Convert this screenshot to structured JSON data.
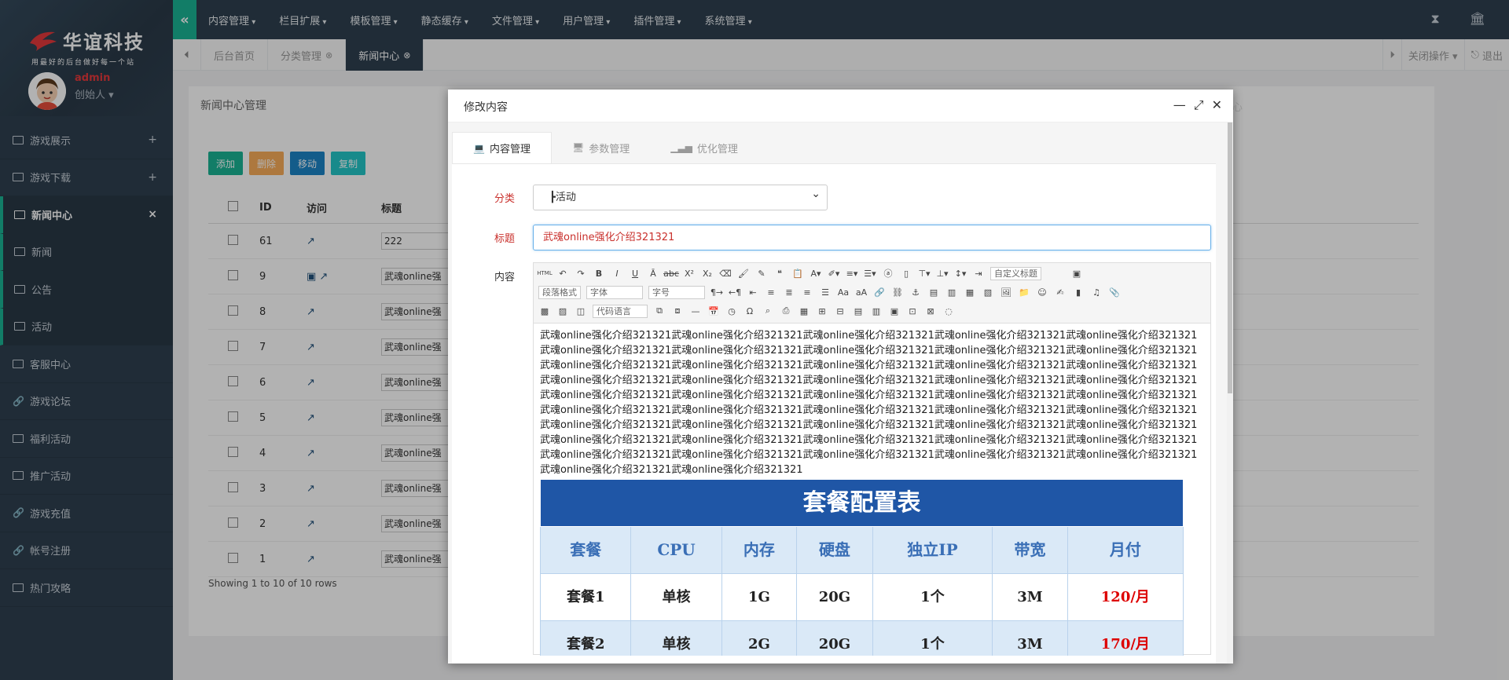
{
  "brand": {
    "name": "华谊科技",
    "slogan": "用最好的后台做好每一个站"
  },
  "user": {
    "name": "admin",
    "role": "创始人 ▾"
  },
  "sidebar": {
    "items": [
      {
        "label": "游戏展示",
        "toggle": "+"
      },
      {
        "label": "游戏下载",
        "toggle": "+"
      },
      {
        "label": "新闻中心",
        "toggle": "×"
      },
      {
        "label": "新闻"
      },
      {
        "label": "公告"
      },
      {
        "label": "活动"
      },
      {
        "label": "客服中心"
      },
      {
        "label": "游戏论坛"
      },
      {
        "label": "福利活动"
      },
      {
        "label": "推广活动"
      },
      {
        "label": "游戏充值"
      },
      {
        "label": "帐号注册"
      },
      {
        "label": "热门攻略"
      }
    ]
  },
  "topnav": {
    "menus": [
      "内容管理",
      "栏目扩展",
      "模板管理",
      "静态缓存",
      "文件管理",
      "用户管理",
      "插件管理",
      "系统管理"
    ],
    "collapse_icon": "«"
  },
  "tabs": {
    "items": [
      "后台首页",
      "分类管理",
      "新闻中心"
    ],
    "close_ops": "关闭操作 ▾",
    "logout": "退出"
  },
  "page": {
    "title": "新闻中心管理",
    "buttons": [
      "添加",
      "删除",
      "移动",
      "复制",
      "+"
    ],
    "columns": [
      "ID",
      "访问",
      "标题"
    ],
    "rows": [
      {
        "id": "61",
        "title": "222"
      },
      {
        "id": "9",
        "title": "武魂online强"
      },
      {
        "id": "8",
        "title": "武魂online强"
      },
      {
        "id": "7",
        "title": "武魂online强"
      },
      {
        "id": "6",
        "title": "武魂online强"
      },
      {
        "id": "5",
        "title": "武魂online强"
      },
      {
        "id": "4",
        "title": "武魂online强"
      },
      {
        "id": "3",
        "title": "武魂online强"
      },
      {
        "id": "2",
        "title": "武魂online强"
      },
      {
        "id": "1",
        "title": "武魂online强"
      }
    ],
    "showing": "Showing 1 to 10 of 10 rows",
    "right_ghost": "心"
  },
  "modal": {
    "title": "修改内容",
    "tabs": [
      "内容管理",
      "参数管理",
      "优化管理"
    ],
    "category_label": "分类",
    "category_value": "┣活动",
    "title_label": "标题",
    "title_value": "武魂online强化介绍321321",
    "content_label": "内容",
    "toolbar": {
      "custom_title": "自定义标题",
      "para_format": "段落格式",
      "font": "字体",
      "font_size": "字号",
      "code_lang": "代码语言",
      "html": "HTML"
    },
    "body_text": "武魂online强化介绍321321武魂online强化介绍321321武魂online强化介绍321321武魂online强化介绍321321武魂online强化介绍321321武魂online强化介绍321321武魂online强化介绍321321武魂online强化介绍321321武魂online强化介绍321321武魂online强化介绍321321武魂online强化介绍321321武魂online强化介绍321321武魂online强化介绍321321武魂online强化介绍321321武魂online强化介绍321321武魂online强化介绍321321武魂online强化介绍321321武魂online强化介绍321321武魂online强化介绍321321武魂online强化介绍321321武魂online强化介绍321321武魂online强化介绍321321武魂online强化介绍321321武魂online强化介绍321321武魂online强化介绍321321武魂online强化介绍321321武魂online强化介绍321321武魂online强化介绍321321武魂online强化介绍321321武魂online强化介绍321321武魂online强化介绍321321武魂online强化介绍321321武魂online强化介绍321321武魂online强化介绍321321武魂online强化介绍321321武魂online强化介绍321321武魂online强化介绍321321武魂online强化介绍321321武魂online强化介绍321321武魂online强化介绍321321武魂online强化介绍321321武魂online强化介绍321321武魂online强化介绍321321武魂online强化介绍321321武魂online强化介绍321321武魂online强化介绍321321武魂online强化介绍321321",
    "package_table": {
      "title": "套餐配置表",
      "headers": [
        "套餐",
        "CPU",
        "内存",
        "硬盘",
        "独立IP",
        "带宽",
        "月付"
      ],
      "rows": [
        [
          "套餐1",
          "单核",
          "1G",
          "20G",
          "1个",
          "3M",
          "120/月"
        ],
        [
          "套餐2",
          "单核",
          "2G",
          "20G",
          "1个",
          "3M",
          "170/月"
        ]
      ]
    }
  },
  "colors": {
    "accent": "#1ab394",
    "sidebar": "#2f4050",
    "danger": "#c9302c",
    "table_blue": "#1f56a6"
  }
}
